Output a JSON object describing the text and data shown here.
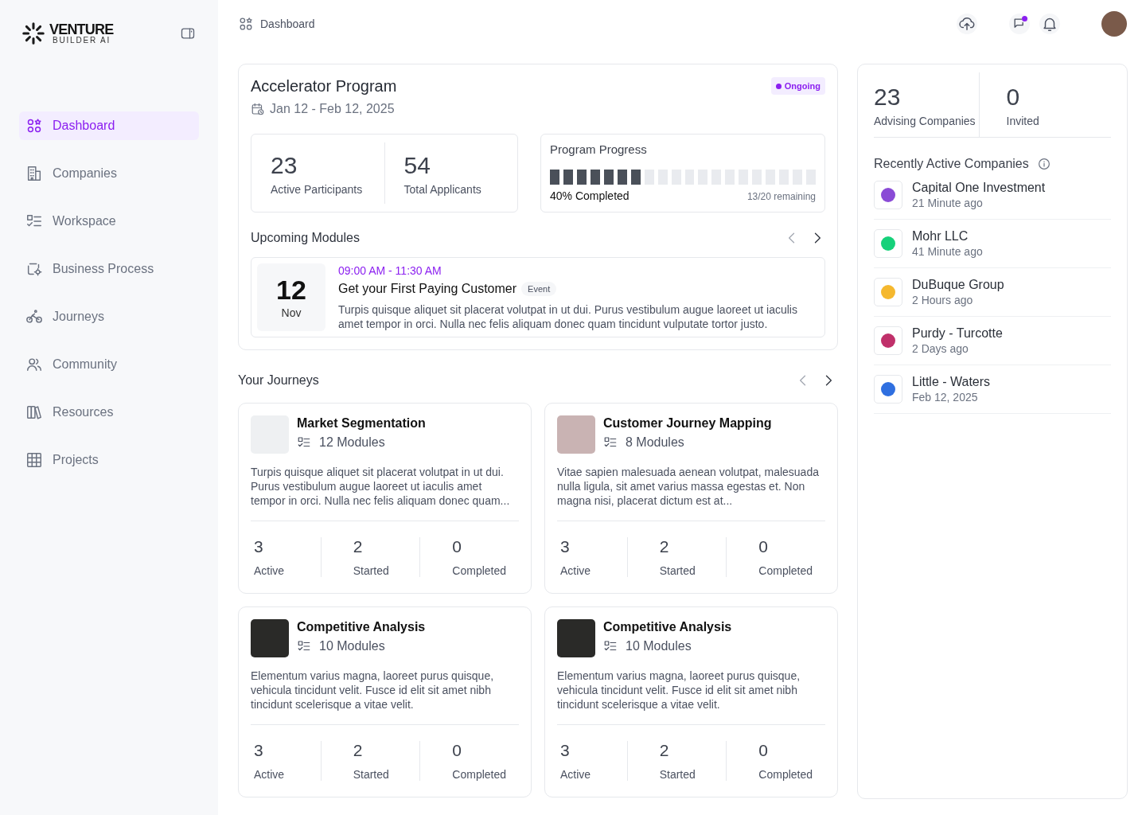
{
  "sidebar": {
    "logo": {
      "name": "VENTURE",
      "tagline": "BUILDER AI"
    },
    "items": [
      {
        "label": "Dashboard",
        "selected": true
      },
      {
        "label": "Companies",
        "selected": false
      },
      {
        "label": "Workspace",
        "selected": false
      },
      {
        "label": "Business Process",
        "selected": false
      },
      {
        "label": "Journeys",
        "selected": false
      },
      {
        "label": "Community",
        "selected": false
      },
      {
        "label": "Resources",
        "selected": false
      },
      {
        "label": "Projects",
        "selected": false
      }
    ]
  },
  "header": {
    "breadcrumb": "Dashboard",
    "has_unread_messages": true
  },
  "program": {
    "title": "Accelerator Program",
    "dates": "Jan 12 - Feb 12, 2025",
    "status": "Ongoing",
    "stats": [
      {
        "value": "23",
        "label": "Active Participants"
      },
      {
        "value": "54",
        "label": "Total Applicants"
      }
    ],
    "progress": {
      "title": "Program Progress",
      "level": 0.35,
      "completed": "40% Completed",
      "remaining": "13/20 remaining"
    },
    "upcoming": {
      "title": "Upcoming Modules",
      "prev_disabled": true,
      "modules": [
        {
          "day": "12",
          "month": "Nov",
          "time": "09:00 AM - 11:30 AM",
          "title": "Get your First Paying Customer",
          "tag": "Event",
          "description": "Turpis quisque aliquet sit placerat volutpat in ut dui. Purus vestibulum augue laoreet ut iaculis amet tempor in orci. Nulla nec felis aliquam donec quam tincidunt vulputate tortor justo."
        }
      ]
    }
  },
  "journeys": {
    "title": "Your Journeys",
    "prev_disabled": true,
    "items": [
      {
        "title": "Market Segmentation",
        "modules": "12 Modules",
        "description": "Turpis quisque aliquet sit placerat volutpat in ut dui. Purus vestibulum augue laoreet ut iaculis amet tempor in orci. Nulla nec felis aliquam donec quam...",
        "stats": [
          {
            "value": "3",
            "label": "Active"
          },
          {
            "value": "2",
            "label": "Started"
          },
          {
            "value": "0",
            "label": "Completed"
          }
        ]
      },
      {
        "title": "Customer Journey Mapping",
        "modules": "8 Modules",
        "description": "Vitae sapien malesuada aenean volutpat, malesuada nulla ligula, sit amet varius massa egestas et. Non magna nisi, placerat dictum est at...",
        "stats": [
          {
            "value": "3",
            "label": "Active"
          },
          {
            "value": "2",
            "label": "Started"
          },
          {
            "value": "0",
            "label": "Completed"
          }
        ]
      },
      {
        "title": "Competitive Analysis",
        "modules": "10 Modules",
        "description": "Elementum varius magna, laoreet purus quisque, vehicula tincidunt velit. Fusce id elit sit amet nibh tincidunt scelerisque a vitae velit.",
        "stats": [
          {
            "value": "3",
            "label": "Active"
          },
          {
            "value": "2",
            "label": "Started"
          },
          {
            "value": "0",
            "label": "Completed"
          }
        ]
      },
      {
        "title": "Competitive Analysis",
        "modules": "10 Modules",
        "description": "Elementum varius magna, laoreet purus quisque, vehicula tincidunt velit. Fusce id elit sit amet nibh tincidunt scelerisque a vitae velit.",
        "stats": [
          {
            "value": "3",
            "label": "Active"
          },
          {
            "value": "2",
            "label": "Started"
          },
          {
            "value": "0",
            "label": "Completed"
          }
        ]
      }
    ]
  },
  "companies_panel": {
    "stats": [
      {
        "value": "23",
        "label": "Advising Companies"
      },
      {
        "value": "0",
        "label": "Invited"
      }
    ],
    "title": "Recently Active Companies",
    "companies": [
      {
        "name": "Capital One Investment",
        "time": "21 Minute ago",
        "color": "#8a4bd6"
      },
      {
        "name": "Mohr LLC",
        "time": "41 Minute ago",
        "color": "#16d17a"
      },
      {
        "name": "DuBuque Group",
        "time": "2 Hours ago",
        "color": "#f5b82e"
      },
      {
        "name": "Purdy - Turcotte",
        "time": "2 Days ago",
        "color": "#c0306a"
      },
      {
        "name": "Little - Waters",
        "time": "Feb 12, 2025",
        "color": "#2f6fe0"
      }
    ]
  }
}
